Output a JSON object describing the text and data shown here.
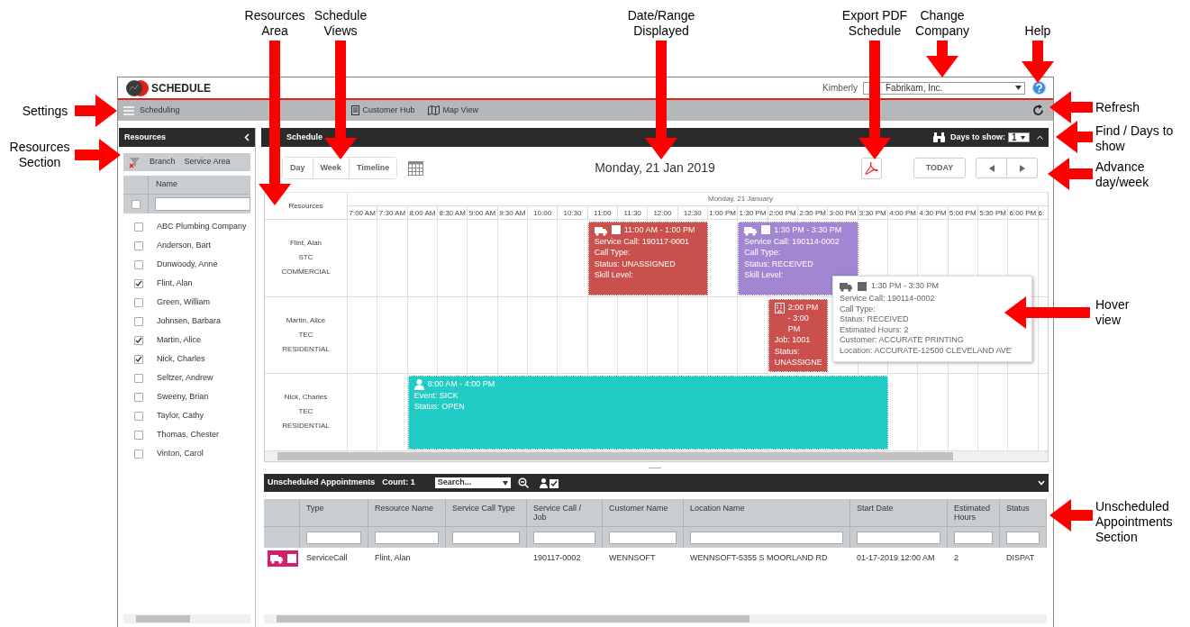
{
  "annotations": [
    {
      "text": "Resources Area"
    },
    {
      "text": "Schedule Views"
    },
    {
      "text": "Date/Range Displayed"
    },
    {
      "text": "Export PDF Schedule"
    },
    {
      "text": "Change Company"
    },
    {
      "text": "Help"
    },
    {
      "text": "Settings"
    },
    {
      "text": "Resources Section"
    },
    {
      "text": "Refresh"
    },
    {
      "text": "Find / Days to show"
    },
    {
      "text": "Advance day/week"
    },
    {
      "text": "Hover view"
    },
    {
      "text": "Unscheduled Appointments Section"
    }
  ],
  "header": {
    "logo": "SCHEDULE",
    "user": "Kimberly",
    "company": "Fabrikam, Inc."
  },
  "toolbar": {
    "menu_label": "Scheduling",
    "links": [
      "Customer Hub",
      "Map View"
    ]
  },
  "resources_panel": {
    "title": "Resources",
    "filters": [
      "Branch",
      "Service Area"
    ],
    "column": "Name",
    "all_checked": false,
    "items": [
      {
        "name": "ABC Plumbing Company",
        "checked": false
      },
      {
        "name": "Anderson, Bart",
        "checked": false
      },
      {
        "name": "Dunwoody, Anne",
        "checked": false
      },
      {
        "name": "Flint, Alan",
        "checked": true
      },
      {
        "name": "Green, William",
        "checked": false
      },
      {
        "name": "Johnsen, Barbara",
        "checked": false
      },
      {
        "name": "Martin, Alice",
        "checked": true
      },
      {
        "name": "Nick, Charles",
        "checked": true
      },
      {
        "name": "Seltzer, Andrew",
        "checked": false
      },
      {
        "name": "Sweeny, Brian",
        "checked": false
      },
      {
        "name": "Taylor, Cathy",
        "checked": false
      },
      {
        "name": "Thomas, Chester",
        "checked": false
      },
      {
        "name": "Vinton, Carol",
        "checked": false
      }
    ]
  },
  "schedule": {
    "title": "Schedule",
    "days_label": "Days to show:",
    "days_value": "1",
    "views": [
      {
        "label": "Day",
        "selected": false
      },
      {
        "label": "Week",
        "selected": false
      },
      {
        "label": "Timeline",
        "selected": false
      }
    ],
    "date": "Monday, 21 Jan 2019",
    "today_button": "TODAY",
    "resources_header": "Resources",
    "day_header": "Monday, 21 January",
    "times": [
      "7:00 AM",
      "7:30 AM",
      "8:00 AM",
      "8:30 AM",
      "9:00 AM",
      "9:30 AM",
      "10:00",
      "10:30",
      "11:00",
      "11:30",
      "12:00",
      "12:30",
      "1:00 PM",
      "1:30 PM",
      "2:00 PM",
      "2:30 PM",
      "3:00 PM",
      "3:30 PM",
      "4:00 PM",
      "4:30 PM",
      "5:00 PM",
      "5:30 PM",
      "6:00 PM",
      "6:"
    ],
    "rows": [
      {
        "lines": [
          "Flint, Alan",
          "STC",
          "COMMERCIAL"
        ],
        "events": [
          {
            "kind": "service_call",
            "color": "#c9504d",
            "lines": [
              "11:00 AM - 1:00 PM",
              "Service Call: 190117-0001",
              "Call Type:",
              "Status: UNASSIGNED",
              "Skill Level:"
            ]
          },
          {
            "kind": "service_call",
            "color": "#a286d2",
            "lines": [
              "1:30 PM - 3:30 PM",
              "Service Call: 190114-0002",
              "Call Type:",
              "Status: RECEIVED",
              "Skill Level:"
            ]
          }
        ]
      },
      {
        "lines": [
          "Martin, Alice",
          "TEC",
          "RESIDENTIAL"
        ],
        "events": [
          {
            "kind": "job",
            "color": "#c9504d",
            "lines": [
              "2:00 PM - 3:00 PM",
              "Job: 1001",
              "Status: UNASSIGNE"
            ]
          }
        ]
      },
      {
        "lines": [
          "Nick, Charles",
          "TEC",
          "RESIDENTIAL"
        ],
        "events": [
          {
            "kind": "event",
            "color": "#22ccc6",
            "lines": [
              "8:00 AM - 4:00 PM",
              "Event: SICK",
              "Status: OPEN"
            ]
          }
        ]
      }
    ],
    "tooltip": {
      "kind": "service_call",
      "lines": [
        "1:30 PM - 3:30 PM",
        "Service Call: 190114-0002",
        "Call Type:",
        "Status: RECEIVED",
        "Estimated Hours: 2",
        "Customer: ACCURATE PRINTING",
        "Location: ACCURATE-12500 CLEVELAND AVE"
      ]
    }
  },
  "unscheduled": {
    "title": "Unscheduled Appointments",
    "count": "Count: 1",
    "search": "Search...",
    "columns": [
      "Type",
      "Resource Name",
      "Service Call Type",
      "Service Call / Job",
      "Customer Name",
      "Location Name",
      "Start Date",
      "Estimated Hours",
      "Status"
    ],
    "rows": [
      {
        "kind": "service_call",
        "cells": [
          "ServiceCall",
          "Flint, Alan",
          "",
          "190117-0002",
          "WENNSOFT",
          "WENNSOFT-5355 S MOORLAND RD",
          "01-17-2019 12:00 AM",
          "2",
          "DISPAT"
        ]
      }
    ]
  }
}
